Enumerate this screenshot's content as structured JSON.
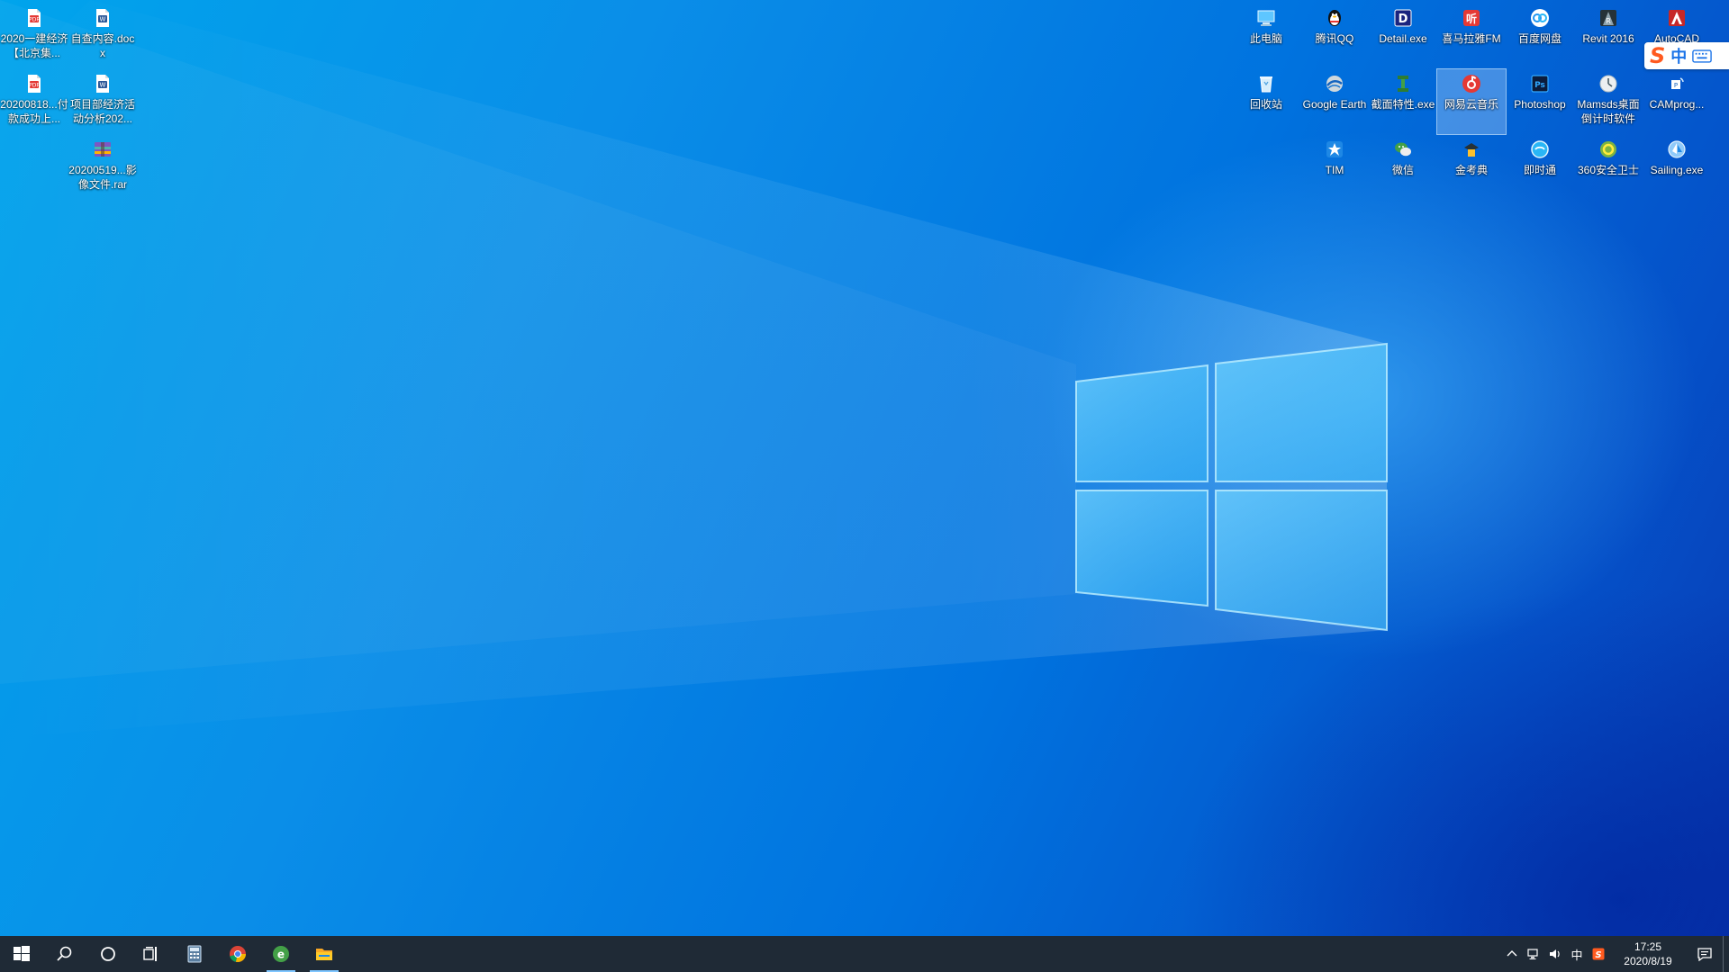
{
  "desktop_left": [
    {
      "id": "doc1",
      "label": "2020一建经济【北京集...",
      "icon": "pdf-file-icon"
    },
    {
      "id": "doc2",
      "label": "自查内容.docx",
      "icon": "word-doc-icon"
    },
    {
      "id": "doc3",
      "label": "20200818...付款成功上...",
      "icon": "pdf-file-icon"
    },
    {
      "id": "doc4",
      "label": "项目部经济活动分析202...",
      "icon": "word-doc-icon"
    },
    {
      "id": "doc5",
      "label": "20200519...影像文件.rar",
      "icon": "rar-archive-icon"
    }
  ],
  "desktop_right": {
    "row1": [
      {
        "label": "此电脑",
        "icon": "this-pc-icon"
      },
      {
        "label": "腾讯QQ",
        "icon": "qq-penguin-icon"
      },
      {
        "label": "Detail.exe",
        "icon": "detail-exe-icon"
      },
      {
        "label": "喜马拉雅FM",
        "icon": "ximalaya-fm-icon"
      },
      {
        "label": "百度网盘",
        "icon": "baidu-netdisk-icon"
      },
      {
        "label": "Revit 2016",
        "icon": "revit-icon"
      },
      {
        "label": "AutoCAD",
        "icon": "autocad-icon"
      }
    ],
    "row2": [
      {
        "label": "回收站",
        "icon": "recycle-bin-icon"
      },
      {
        "label": "Google Earth",
        "icon": "google-earth-icon"
      },
      {
        "label": "截面特性.exe",
        "icon": "section-property-icon"
      },
      {
        "label": "网易云音乐",
        "icon": "netease-music-icon",
        "selected": true
      },
      {
        "label": "Photoshop",
        "icon": "photoshop-icon"
      },
      {
        "label": "Mamsds桌面倒计时软件",
        "icon": "countdown-app-icon"
      },
      {
        "label": "CAMprog...",
        "icon": "camprog-icon"
      }
    ],
    "row3": [
      {
        "label": "TIM",
        "icon": "tim-icon"
      },
      {
        "label": "微信",
        "icon": "wechat-icon"
      },
      {
        "label": "金考典",
        "icon": "jinkaodian-icon"
      },
      {
        "label": "即时通",
        "icon": "instant-messenger-icon"
      },
      {
        "label": "360安全卫士",
        "icon": "360-security-icon"
      },
      {
        "label": "Sailing.exe",
        "icon": "sailing-exe-icon"
      }
    ]
  },
  "ime": {
    "mode": "中"
  },
  "taskbar": {
    "pinned": [
      {
        "name": "calculator",
        "icon": "calculator-icon"
      },
      {
        "name": "chrome",
        "icon": "chrome-icon"
      },
      {
        "name": "browser-360",
        "icon": "browser-e-icon",
        "open": true
      },
      {
        "name": "file-explorer",
        "icon": "folder-icon",
        "open": true
      }
    ]
  },
  "tray": {
    "ime_indicator": "中",
    "time": "17:25",
    "date": "2020/8/19"
  },
  "colors": {
    "taskbar_bg": "#1f2a36",
    "desktop_accent": "#0078d7"
  }
}
